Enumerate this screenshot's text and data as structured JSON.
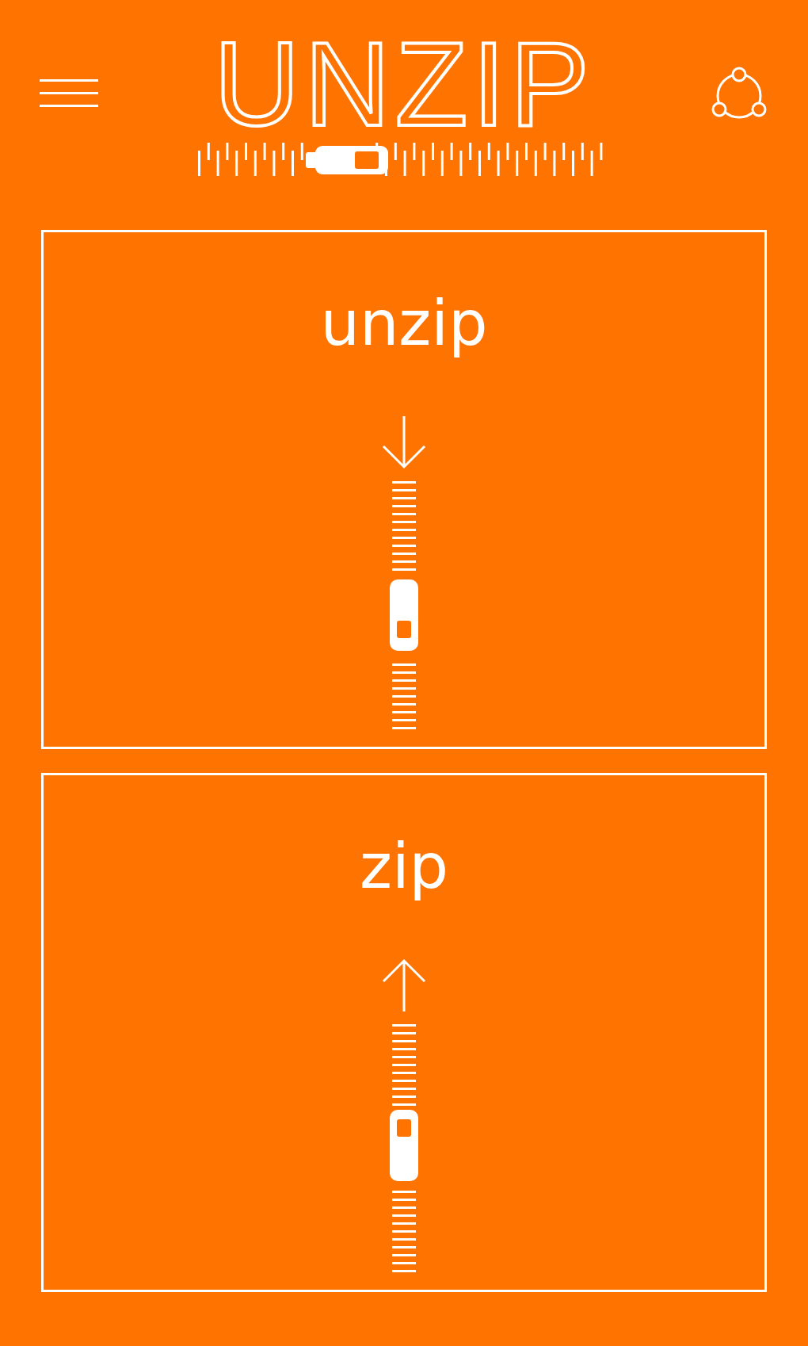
{
  "header": {
    "logo": "UNZIP"
  },
  "cards": [
    {
      "title": "unzip",
      "kind": "down"
    },
    {
      "title": "zip",
      "kind": "up"
    }
  ]
}
